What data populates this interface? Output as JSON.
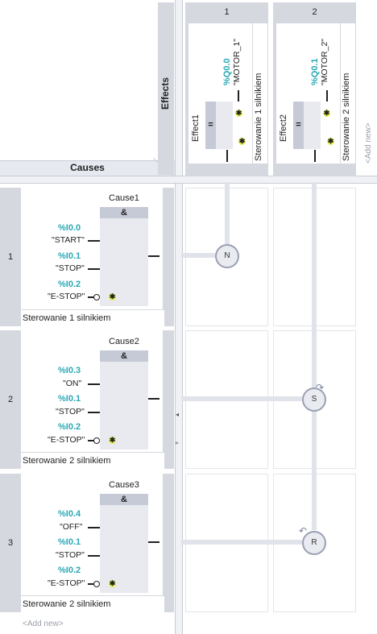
{
  "header": {
    "causes_label": "Causes",
    "effects_label": "Effects",
    "add_new_label": "<Add new>"
  },
  "effects": [
    {
      "column": "1",
      "name": "Effect1",
      "gate": "=",
      "address": "%Q0.0",
      "symbol": "\"MOTOR_1\"",
      "comment": "Sterowanie 1 silnikiem"
    },
    {
      "column": "2",
      "name": "Effect2",
      "gate": "=",
      "address": "%Q0.1",
      "symbol": "\"MOTOR_2\"",
      "comment": "Sterowanie 2 silnikiem"
    }
  ],
  "causes": [
    {
      "row": "1",
      "name": "Cause1",
      "gate": "&",
      "inputs": [
        {
          "address": "%I0.0",
          "symbol": "\"START\""
        },
        {
          "address": "%I0.1",
          "symbol": "\"STOP\""
        },
        {
          "address": "%I0.2",
          "symbol": "\"E-STOP\""
        }
      ],
      "comment": "Sterowanie 1 silnikiem"
    },
    {
      "row": "2",
      "name": "Cause2",
      "gate": "&",
      "inputs": [
        {
          "address": "%I0.3",
          "symbol": "\"ON\""
        },
        {
          "address": "%I0.1",
          "symbol": "\"STOP\""
        },
        {
          "address": "%I0.2",
          "symbol": "\"E-STOP\""
        }
      ],
      "comment": "Sterowanie 2 silnikiem"
    },
    {
      "row": "3",
      "name": "Cause3",
      "gate": "&",
      "inputs": [
        {
          "address": "%I0.4",
          "symbol": "\"OFF\""
        },
        {
          "address": "%I0.1",
          "symbol": "\"STOP\""
        },
        {
          "address": "%I0.2",
          "symbol": "\"E-STOP\""
        }
      ],
      "comment": "Sterowanie 2 silnikiem"
    }
  ],
  "intersections": [
    {
      "label": "N"
    },
    {
      "label": "S"
    },
    {
      "label": "R"
    }
  ],
  "footer": {
    "add_new_label": "<Add new>"
  },
  "colors": {
    "address": "#2aa8b5",
    "panel": "#d6d8df",
    "gate_body": "#e8eaf0"
  }
}
